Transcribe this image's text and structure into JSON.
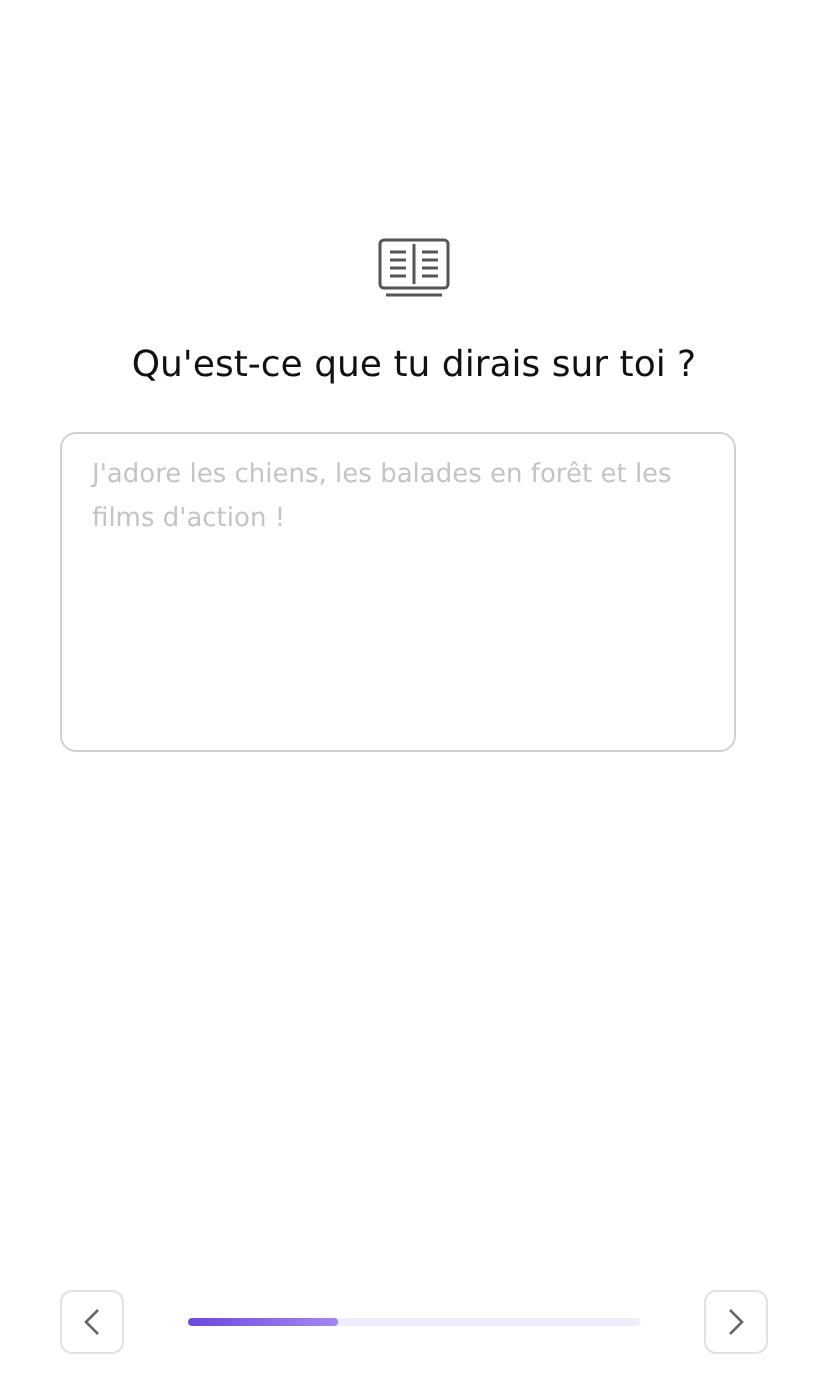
{
  "question": {
    "title": "Qu'est-ce que tu dirais sur toi ?"
  },
  "answer": {
    "placeholder": "J'adore les chiens, les balades en forêt et les films d'action !"
  },
  "progress": {
    "level": 0.33
  }
}
